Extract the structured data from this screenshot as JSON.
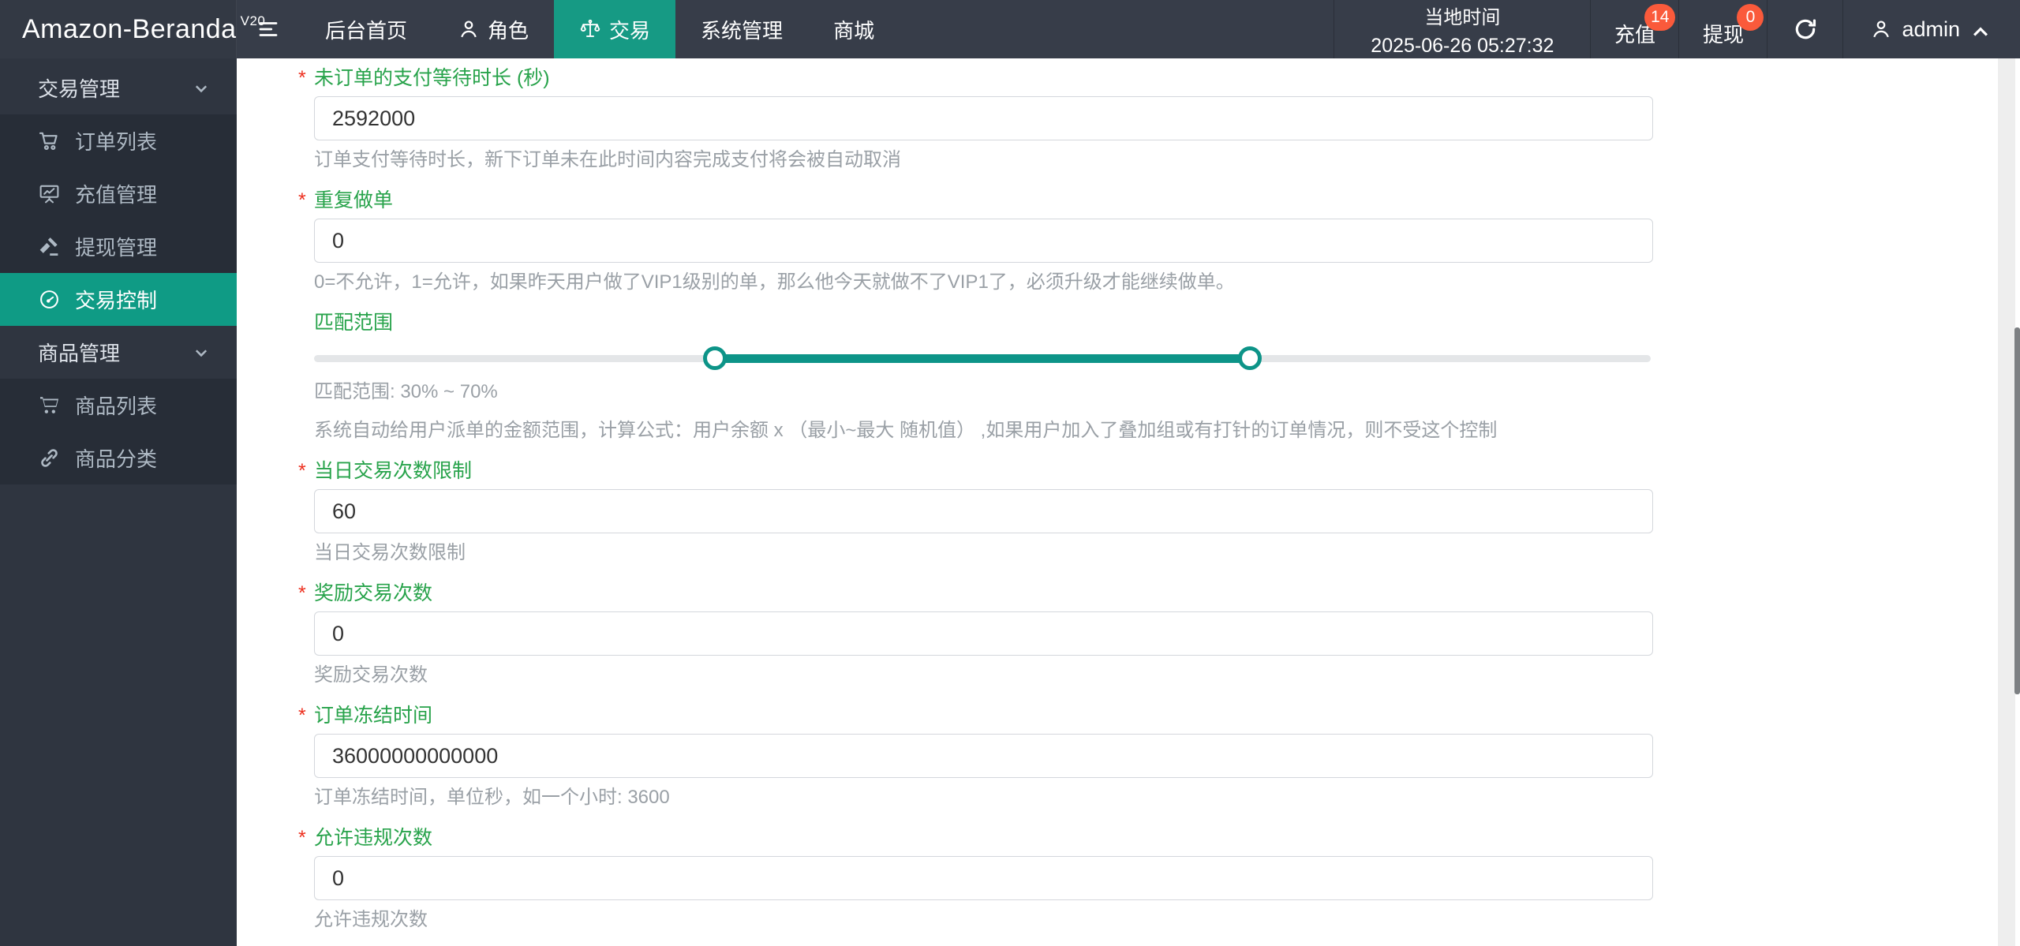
{
  "app": {
    "title": "Amazon-Beranda",
    "version": "V20"
  },
  "header": {
    "nav": [
      {
        "label": "后台首页"
      },
      {
        "label": "角色",
        "icon": "user-icon"
      },
      {
        "label": "交易",
        "icon": "scales-icon",
        "active": true
      },
      {
        "label": "系统管理"
      },
      {
        "label": "商城"
      }
    ],
    "local_time": {
      "label": "当地时间",
      "value": "2025-06-26 05:27:32"
    },
    "recharge": {
      "label": "充值",
      "badge": "14"
    },
    "withdraw": {
      "label": "提现",
      "badge": "0"
    },
    "user": {
      "name": "admin"
    }
  },
  "sidebar": {
    "groups": [
      {
        "label": "交易管理",
        "items": [
          {
            "label": "订单列表",
            "icon": "cart-icon"
          },
          {
            "label": "充值管理",
            "icon": "board-chart-icon"
          },
          {
            "label": "提现管理",
            "icon": "gavel-icon"
          },
          {
            "label": "交易控制",
            "icon": "gauge-icon",
            "active": true
          }
        ]
      },
      {
        "label": "商品管理",
        "items": [
          {
            "label": "商品列表",
            "icon": "cart-icon"
          },
          {
            "label": "商品分类",
            "icon": "link-icon"
          }
        ]
      }
    ]
  },
  "form": {
    "required_marker": "*",
    "fields": [
      {
        "type": "input",
        "required": true,
        "label": "未订单的支付等待时长 (秒)",
        "value": "2592000",
        "helper": "订单支付等待时长，新下订单未在此时间内容完成支付将会被自动取消"
      },
      {
        "type": "input",
        "required": true,
        "label": "重复做单",
        "value": "0",
        "helper": "0=不允许，1=允许，如果昨天用户做了VIP1级别的单，那么他今天就做不了VIP1了，必须升级才能继续做单。"
      },
      {
        "type": "range-slider",
        "required": false,
        "label": "匹配范围",
        "min_percent": 30,
        "max_percent": 70,
        "helper": "匹配范围: 30% ~ 70%",
        "helper2": "系统自动给用户派单的金额范围，计算公式：用户余额 x （最小~最大 随机值） ,如果用户加入了叠加组或有打针的订单情况，则不受这个控制"
      },
      {
        "type": "input",
        "required": true,
        "label": "当日交易次数限制",
        "value": "60",
        "helper": "当日交易次数限制"
      },
      {
        "type": "input",
        "required": true,
        "label": "奖励交易次数",
        "value": "0",
        "helper": "奖励交易次数"
      },
      {
        "type": "input",
        "required": true,
        "label": "订单冻结时间",
        "value": "36000000000000",
        "helper": "订单冻结时间，单位秒，如一个小时: 3600"
      },
      {
        "type": "input",
        "required": true,
        "label": "允许违规次数",
        "value": "0",
        "helper": "允许违规次数"
      }
    ]
  },
  "colors": {
    "header_bg": "#373d49",
    "sidebar_bg": "#2f3540",
    "submenu_bg": "#272d37",
    "active_teal": "#0f9b85",
    "slider_teal": "#0d9488",
    "label_green": "#28a34b",
    "asterisk_red": "#ed2f1e",
    "badge_red": "#fa5a3b"
  }
}
